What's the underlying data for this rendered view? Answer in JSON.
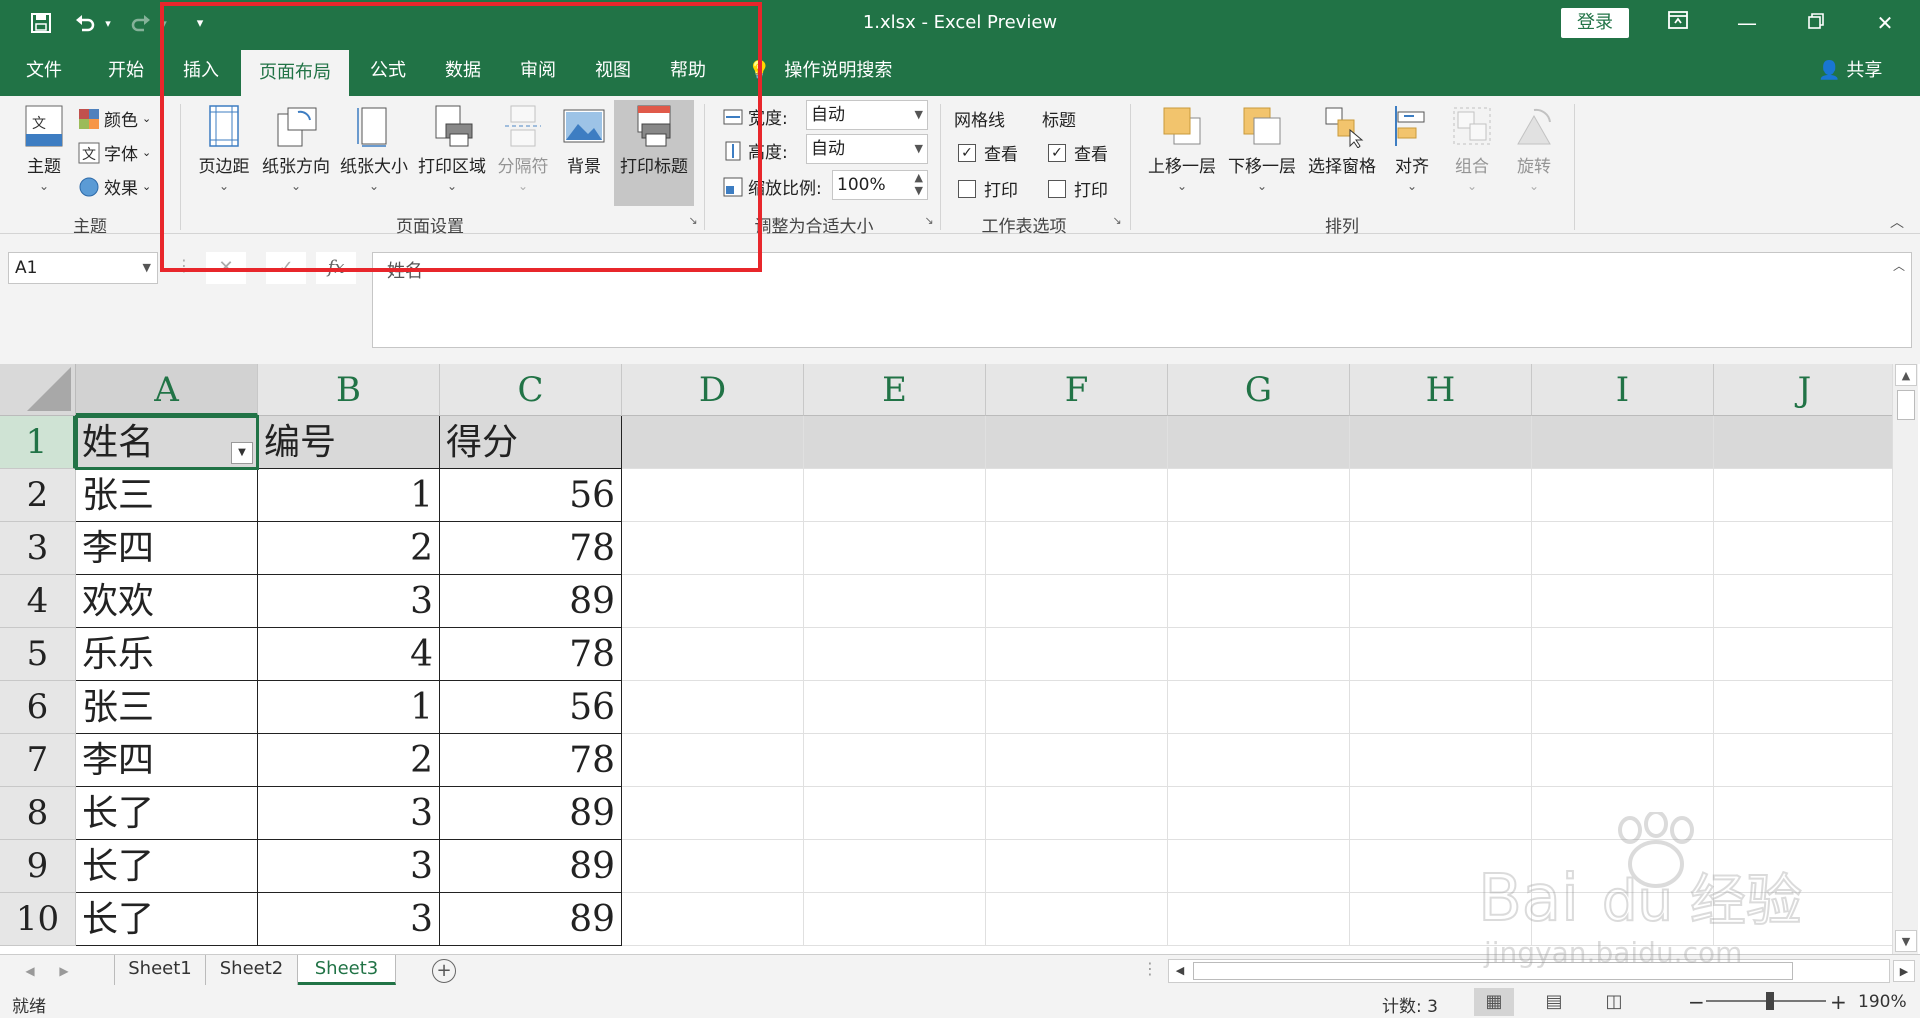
{
  "titlebar": {
    "doc_title": "1.xlsx  -  Excel Preview",
    "login_label": "登录",
    "save_icon": "save-icon",
    "undo_icon": "undo-icon",
    "redo_icon": "redo-icon",
    "customize_icon": "customize-icon"
  },
  "tabs": [
    {
      "label": "文件"
    },
    {
      "label": "开始"
    },
    {
      "label": "插入"
    },
    {
      "label": "页面布局"
    },
    {
      "label": "公式"
    },
    {
      "label": "数据"
    },
    {
      "label": "审阅"
    },
    {
      "label": "视图"
    },
    {
      "label": "帮助"
    }
  ],
  "active_tab": "页面布局",
  "tell_me": "操作说明搜索",
  "share": "共享",
  "ribbon": {
    "themes": {
      "main": "主题",
      "colors": "颜色",
      "fonts": "字体",
      "effects": "效果",
      "group": "主题"
    },
    "page_setup": {
      "margins": "页边距",
      "orientation": "纸张方向",
      "size": "纸张大小",
      "print_area": "打印区域",
      "breaks": "分隔符",
      "background": "背景",
      "print_titles": "打印标题",
      "group": "页面设置"
    },
    "scale": {
      "width_label": "宽度:",
      "width_value": "自动",
      "height_label": "高度:",
      "height_value": "自动",
      "scale_label": "缩放比例:",
      "scale_value": "100%",
      "group": "调整为合适大小"
    },
    "sheet_options": {
      "gridlines": "网格线",
      "headings": "标题",
      "view": "查看",
      "print": "打印",
      "group": "工作表选项"
    },
    "arrange": {
      "bring_forward": "上移一层",
      "send_backward": "下移一层",
      "selection_pane": "选择窗格",
      "align": "对齐",
      "group_btn": "组合",
      "rotate": "旋转",
      "group": "排列"
    }
  },
  "formula_bar": {
    "name_box": "A1",
    "cancel": "✕",
    "enter": "✓",
    "fx": "fx",
    "content": "姓名"
  },
  "columns": [
    "A",
    "B",
    "C",
    "D",
    "E",
    "F",
    "G",
    "H",
    "I",
    "J"
  ],
  "rows": [
    "1",
    "2",
    "3",
    "4",
    "5",
    "6",
    "7",
    "8",
    "9",
    "10"
  ],
  "table": {
    "headers": [
      "姓名",
      "编号",
      "得分"
    ],
    "rows": [
      [
        "张三",
        "1",
        "56"
      ],
      [
        "李四",
        "2",
        "78"
      ],
      [
        "欢欢",
        "3",
        "89"
      ],
      [
        "乐乐",
        "4",
        "78"
      ],
      [
        "张三",
        "1",
        "56"
      ],
      [
        "李四",
        "2",
        "78"
      ],
      [
        "长了",
        "3",
        "89"
      ],
      [
        "长了",
        "3",
        "89"
      ],
      [
        "长了",
        "3",
        "89"
      ]
    ]
  },
  "sheets": [
    {
      "label": "Sheet1"
    },
    {
      "label": "Sheet2"
    },
    {
      "label": "Sheet3"
    }
  ],
  "active_sheet": "Sheet3",
  "status": {
    "ready": "就绪",
    "count": "计数: 3",
    "zoom": "190%",
    "zoom_level": 1.9
  },
  "watermark": {
    "brand": "Bai",
    "brand2": "经验",
    "url": "jingyan.baidu.com"
  },
  "colors": {
    "excel_green": "#217346",
    "highlight_red": "#e8262b"
  }
}
